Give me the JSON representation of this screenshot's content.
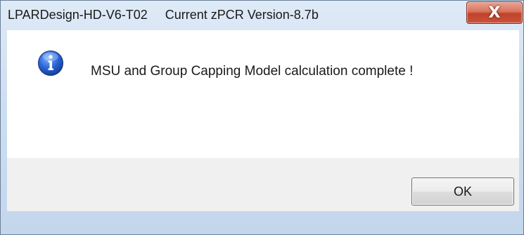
{
  "window": {
    "title": "LPARDesign-HD-V6-T02     Current zPCR Version-8.7b",
    "close_glyph": "X"
  },
  "dialog": {
    "icon": "info-icon",
    "message": "MSU and Group Capping Model calculation complete !",
    "ok_label": "OK"
  }
}
